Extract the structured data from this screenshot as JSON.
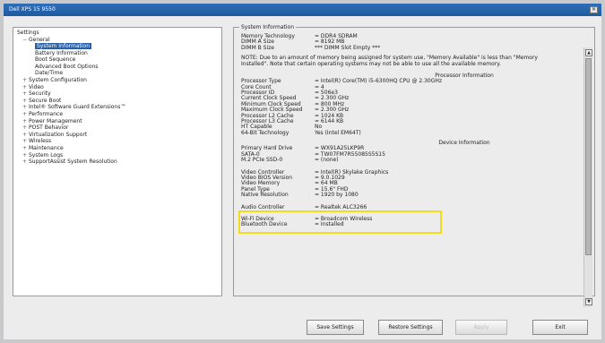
{
  "window": {
    "title": "Dell XPS 15 9550",
    "close_glyph": "✕"
  },
  "tree": {
    "root": "Settings",
    "items": [
      {
        "label": "General",
        "level": 1,
        "expander": "−"
      },
      {
        "label": "System Information",
        "level": 2,
        "selected": true
      },
      {
        "label": "Battery Information",
        "level": 2
      },
      {
        "label": "Boot Sequence",
        "level": 2
      },
      {
        "label": "Advanced Boot Options",
        "level": 2
      },
      {
        "label": "Date/Time",
        "level": 2
      },
      {
        "label": "System Configuration",
        "level": 1,
        "expander": "+"
      },
      {
        "label": "Video",
        "level": 1,
        "expander": "+"
      },
      {
        "label": "Security",
        "level": 1,
        "expander": "+"
      },
      {
        "label": "Secure Boot",
        "level": 1,
        "expander": "+"
      },
      {
        "label": "Intel® Software Guard Extensions™",
        "level": 1,
        "expander": "+"
      },
      {
        "label": "Performance",
        "level": 1,
        "expander": "+"
      },
      {
        "label": "Power Management",
        "level": 1,
        "expander": "+"
      },
      {
        "label": "POST Behavior",
        "level": 1,
        "expander": "+"
      },
      {
        "label": "Virtualization Support",
        "level": 1,
        "expander": "+"
      },
      {
        "label": "Wireless",
        "level": 1,
        "expander": "+"
      },
      {
        "label": "Maintenance",
        "level": 1,
        "expander": "+"
      },
      {
        "label": "System Logs",
        "level": 1,
        "expander": "+"
      },
      {
        "label": "SupportAssist System Resolution",
        "level": 1,
        "expander": "+"
      }
    ]
  },
  "info": {
    "title": "System Information",
    "memory_rows": [
      {
        "k": "Memory Technology",
        "v": "= DDR4 SDRAM"
      },
      {
        "k": "DIMM A Size",
        "v": "= 8192 MB"
      },
      {
        "k": "DIMM B Size",
        "v": "*** DIMM Slot Empty ***"
      }
    ],
    "note": "NOTE: Due to an amount of memory being assigned for system use, \"Memory Available\" is less than \"Memory Installed\". Note that certain operating systems may not be able to use all the available memory.",
    "processor_head": "Processor Information",
    "processor_rows": [
      {
        "k": "Processor Type",
        "v": "= Intel(R) Core(TM) i5-6300HQ CPU @ 2.30GHz"
      },
      {
        "k": "Core Count",
        "v": "= 4"
      },
      {
        "k": "Processor ID",
        "v": "= 506e3"
      },
      {
        "k": "Current Clock Speed",
        "v": "= 2.300 GHz"
      },
      {
        "k": "Minimum Clock Speed",
        "v": "= 800 MHz"
      },
      {
        "k": "Maximum Clock Speed",
        "v": "= 2.300 GHz"
      },
      {
        "k": "Processor L2 Cache",
        "v": "= 1024 KB"
      },
      {
        "k": "Processor L3 Cache",
        "v": "= 6144 KB"
      },
      {
        "k": "HT Capable",
        "v": "No"
      },
      {
        "k": "64-Bit Technology",
        "v": "Yes (Intel EM64T)"
      }
    ],
    "device_head": "Device Information",
    "drive_rows": [
      {
        "k": "Primary Hard Drive",
        "v": "= WX91A25LKP9R"
      },
      {
        "k": "SATA-0",
        "v": "= TW07FM7R55085S5S15"
      },
      {
        "k": "M.2 PCIe SSD-0",
        "v": "= (none)"
      }
    ],
    "video_rows": [
      {
        "k": "Video Controller",
        "v": "= Intel(R) Skylake Graphics"
      },
      {
        "k": "Video BIOS Version",
        "v": "= 9.0.1029"
      },
      {
        "k": "Video Memory",
        "v": "= 64 MB"
      },
      {
        "k": "Panel Type",
        "v": "= 15.6\" FHD"
      },
      {
        "k": "Native Resolution",
        "v": "= 1920 by 1080"
      }
    ],
    "audio_rows": [
      {
        "k": "Audio Controller",
        "v": "= Realtek ALC3266"
      }
    ],
    "wireless_rows": [
      {
        "k": "Wi-Fi Device",
        "v": "= Broadcom Wireless"
      },
      {
        "k": "Bluetooth Device",
        "v": "= Installed"
      }
    ]
  },
  "buttons": {
    "save": "Save Settings",
    "restore": "Restore Settings",
    "apply": "Apply",
    "exit": "Exit"
  },
  "scroll": {
    "up_glyph": "▲",
    "down_glyph": "▼"
  },
  "colors": {
    "title_bar": "#1f5aa0",
    "selected": "#2b5fa6",
    "highlight": "#f5dc18"
  }
}
